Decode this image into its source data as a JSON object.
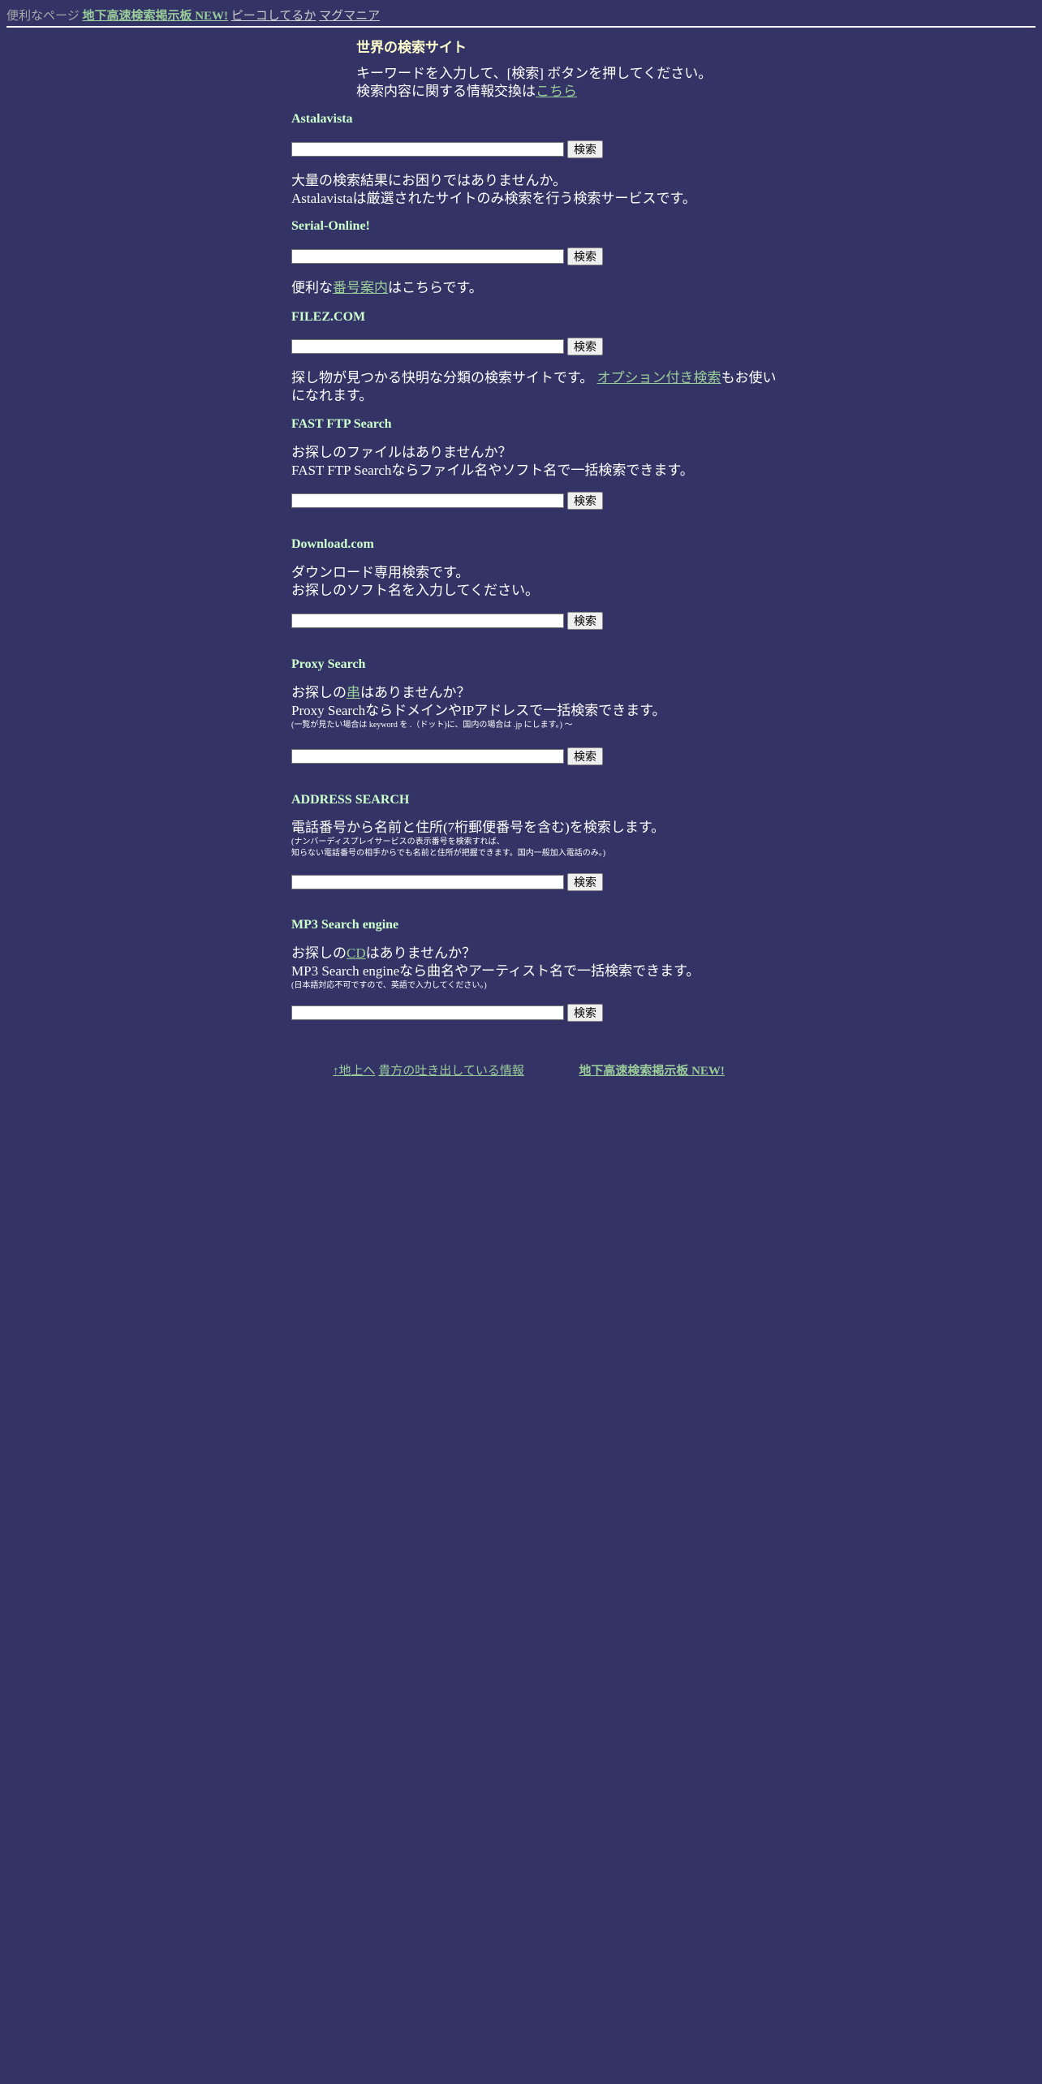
{
  "topbar": {
    "prefix": "便利なページ",
    "link_bbs": "地下高速検索掲示板 NEW!",
    "link_peeko": "ピーコしてるか",
    "link_mag": "マグマニア"
  },
  "page": {
    "title": "世界の検索サイト",
    "intro_line1": "キーワードを入力して、[検索] ボタンを押してください。",
    "intro_line2_prefix": "検索内容に関する情報交換は",
    "intro_link": "こちら"
  },
  "button_label": "検索",
  "sections": {
    "astalavista": {
      "title": "Astalavista",
      "desc1": "大量の検索結果にお困りではありませんか。",
      "desc2": "Astalavistaは厳選されたサイトのみ検索を行う検索サービスです。"
    },
    "serial": {
      "title": "Serial-Online!",
      "desc_prefix": "便利な",
      "desc_link": "番号案内",
      "desc_suffix": "はこちらです。"
    },
    "filez": {
      "title": "FILEZ.COM",
      "desc_prefix": "探し物が見つかる快明な分類の検索サイトです。 ",
      "desc_link": "オプション付き検索",
      "desc_suffix": "もお使い",
      "desc_line2": "になれます。"
    },
    "fastftp": {
      "title": "FAST FTP Search",
      "desc1": "お探しのファイルはありませんか？",
      "desc2": "FAST FTP Searchならファイル名やソフト名で一括検索できます。"
    },
    "download": {
      "title": "Download.com",
      "desc1": "ダウンロード専用検索です。",
      "desc2": "お探しのソフト名を入力してください。"
    },
    "proxy": {
      "title": "Proxy Search",
      "desc1_prefix": "お探しの",
      "desc1_link": "串",
      "desc1_suffix": "はありませんか？",
      "desc2": "Proxy SearchならドメインやIPアドレスで一括検索できます。",
      "note": "(一覧が見たい場合は keyword を .（ドット)に、国内の場合は .jp にします。) 〜"
    },
    "address": {
      "title": "ADDRESS SEARCH",
      "desc1": "電話番号から名前と住所(7桁郵便番号を含む)を検索します。",
      "note1": "(ナンバーディスプレイサービスの表示番号を検索すれば、",
      "note2": "知らない電話番号の相手からでも名前と住所が把握できます。国内一般加入電話のみ。)"
    },
    "mp3": {
      "title": "MP3 Search engine",
      "desc1_prefix": "お探しの",
      "desc1_link": "CD",
      "desc1_suffix": "はありませんか？",
      "desc2": "MP3 Search engineなら曲名やアーティスト名で一括検索できます。",
      "note": "(日本語対応不可ですので、英語で入力してください。)"
    }
  },
  "footer": {
    "link_ground": "↑地上へ",
    "link_info": "貴方の吐き出している情報",
    "link_bbs": "地下高速検索掲示板 NEW!"
  }
}
